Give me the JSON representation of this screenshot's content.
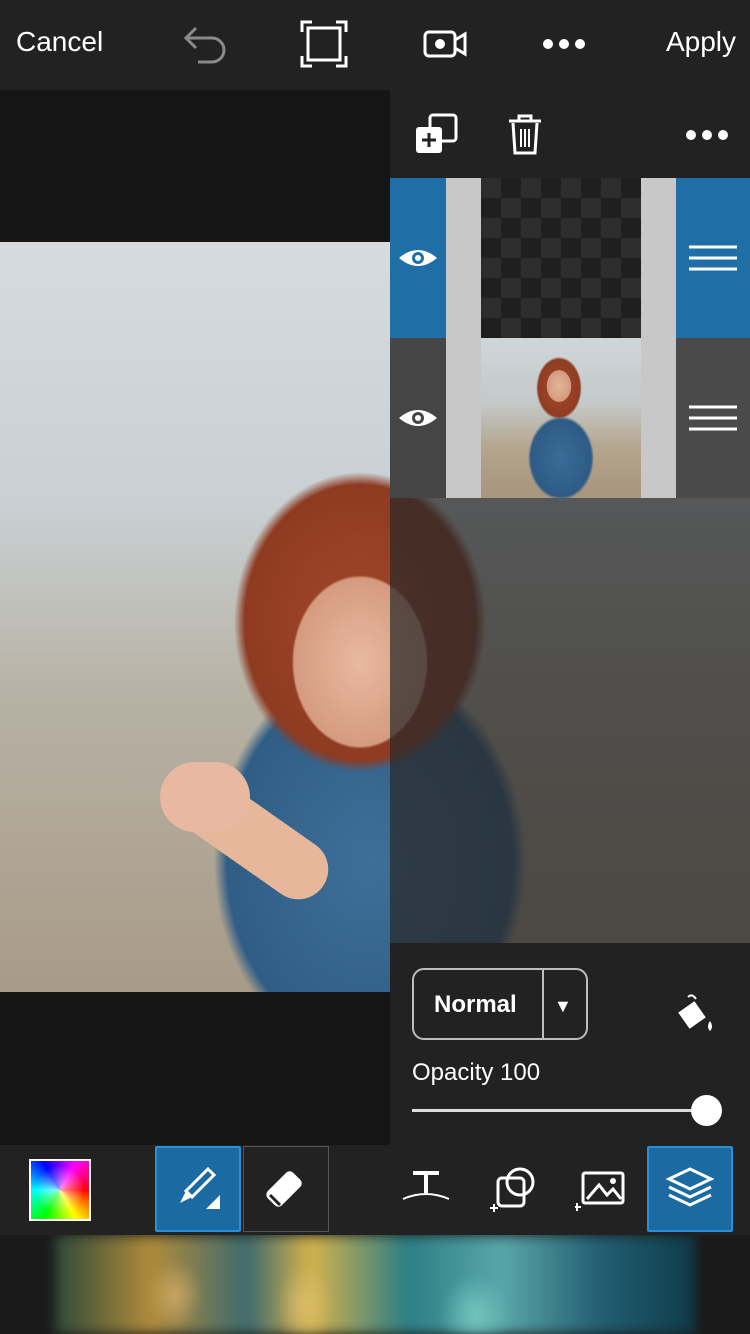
{
  "topbar": {
    "cancel_label": "Cancel",
    "apply_label": "Apply",
    "icons": [
      "undo-icon",
      "crop-icon",
      "video-icon",
      "more-icon"
    ]
  },
  "layers_panel": {
    "header_icons": [
      "add-layer-icon",
      "trash-icon",
      "more-icon"
    ],
    "layers": [
      {
        "visible": true,
        "selected": true,
        "type": "transparent"
      },
      {
        "visible": true,
        "selected": false,
        "type": "photo"
      }
    ]
  },
  "properties": {
    "blend_mode": "Normal",
    "opacity_label": "Opacity 100",
    "opacity_value": 100
  },
  "toolbar": {
    "tools": [
      "color-picker",
      "brush-tool",
      "eraser-tool",
      "text-tool",
      "shape-tool",
      "add-photo-tool",
      "layers-tool"
    ],
    "active_tools": [
      "brush-tool",
      "layers-tool"
    ]
  },
  "colors": {
    "accent": "#1c6aa2",
    "topbar_bg": "#222222",
    "selected_layer": "#1f6fa6"
  }
}
